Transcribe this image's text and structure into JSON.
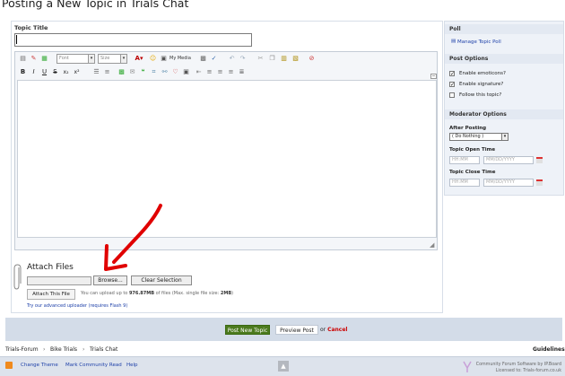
{
  "page": {
    "title": "Posting a New Topic in Trials Chat"
  },
  "form": {
    "topic_title_label": "Topic Title",
    "topic_title_value": ""
  },
  "editor": {
    "font_select": "Font",
    "size_select": "Size",
    "my_media_label": "My Media",
    "toolbar_icons": [
      "source-icon",
      "eraser-icon",
      "table-icon",
      "font-color-icon",
      "emoticon-icon",
      "my-media-icon",
      "special-char-icon",
      "spellcheck-icon",
      "undo-icon",
      "redo-icon",
      "cut-icon",
      "copy-icon",
      "paste-icon",
      "paste-word-icon",
      "remove-format-icon"
    ],
    "format_buttons": [
      "B",
      "I",
      "U",
      "S",
      "x₂",
      "x²"
    ],
    "format_icons": [
      "bullet-list-icon",
      "numbered-list-icon",
      "image-icon",
      "email-icon",
      "quote-icon",
      "code-icon",
      "link-icon",
      "unlink-icon",
      "spoiler-icon",
      "outdent-icon",
      "align-left-icon",
      "align-center-icon",
      "align-right-icon",
      "justify-icon"
    ]
  },
  "attach": {
    "heading": "Attach Files",
    "browse_label": "Browse...",
    "clear_label": "Clear Selection",
    "attach_this_label": "Attach This File",
    "upload_note_prefix": "You can upload up to ",
    "upload_amount": "976.87MB",
    "upload_note_mid": " of files (Max. single file size: ",
    "upload_max": "2MB",
    "upload_note_suffix": ")",
    "advanced_link": "Try our advanced uploader (requires Flash 9)"
  },
  "sidebar": {
    "poll_heading": "Poll",
    "manage_poll_link": "Manage Topic Poll",
    "post_options_heading": "Post Options",
    "options": [
      {
        "label": "Enable emoticons?",
        "checked": "✓"
      },
      {
        "label": "Enable signature?",
        "checked": "✓"
      },
      {
        "label": "Follow this topic?",
        "checked": ""
      }
    ],
    "mod_options_heading": "Moderator Options",
    "after_posting_label": "After Posting",
    "after_posting_value": "( Do Nothing )",
    "open_time_label": "Topic Open Time",
    "close_time_label": "Topic Close Time",
    "time_placeholder": "HH:MM",
    "date_placeholder": "MM/DD/YYYY"
  },
  "actions": {
    "post_label": "Post New Topic",
    "preview_label": "Preview Post",
    "or_label": "or",
    "cancel_label": "Cancel"
  },
  "breadcrumb": {
    "items": [
      "Trials-Forum",
      "Bike Trials",
      "Trials Chat"
    ],
    "separator": "›",
    "guidelines": "Guidelines"
  },
  "footer": {
    "change_theme": "Change Theme",
    "mark_read": "Mark Community Read",
    "help": "Help",
    "credit_line1": "Community Forum Software by IP.Board",
    "credit_line2": "Licensed to: Trials-forum.co.uk"
  },
  "colors": {
    "post_button": "#4c7a1e",
    "action_bar": "#d3dce8",
    "sidebar_bg": "#eef2f8",
    "annotation_arrow": "#e00000",
    "link": "#1c3fa8"
  }
}
